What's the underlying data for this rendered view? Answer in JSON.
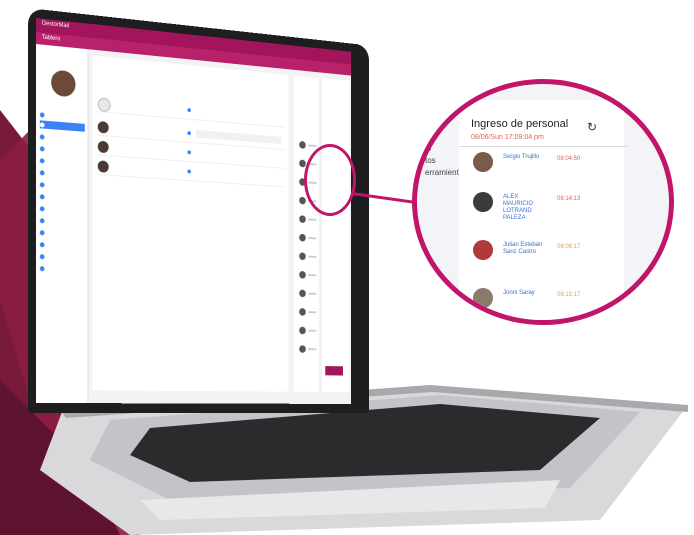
{
  "app": {
    "topbar_title": "GestorMail",
    "sub_title": "Tablero"
  },
  "main": {
    "panel_title": "Ingreso de personal"
  },
  "zoom": {
    "title": "Ingreso de personal",
    "date": "08/06/Sun 17:09:04 pm",
    "refresh_icon": "refresh-icon",
    "items": [
      {
        "name": "Sergio Trujillo",
        "time": "08:04:50",
        "color": "#e0615a"
      },
      {
        "name": "ALEX MAURICIO LOTRAND PALEZA",
        "time": "08:14:13",
        "color": "#e0615a"
      },
      {
        "name": "Julian Esteban Sanz Castro",
        "time": "08:06:17",
        "color": "#e3a53a"
      },
      {
        "name": "Jonni Saray",
        "time": "08:15:17",
        "color": "#e3a53a"
      }
    ],
    "side_text": [
      "lo",
      "tos",
      "erramienta"
    ]
  },
  "colors": {
    "accent": "#c1156a",
    "header": "#a3155a",
    "link": "#3b6fd6"
  }
}
